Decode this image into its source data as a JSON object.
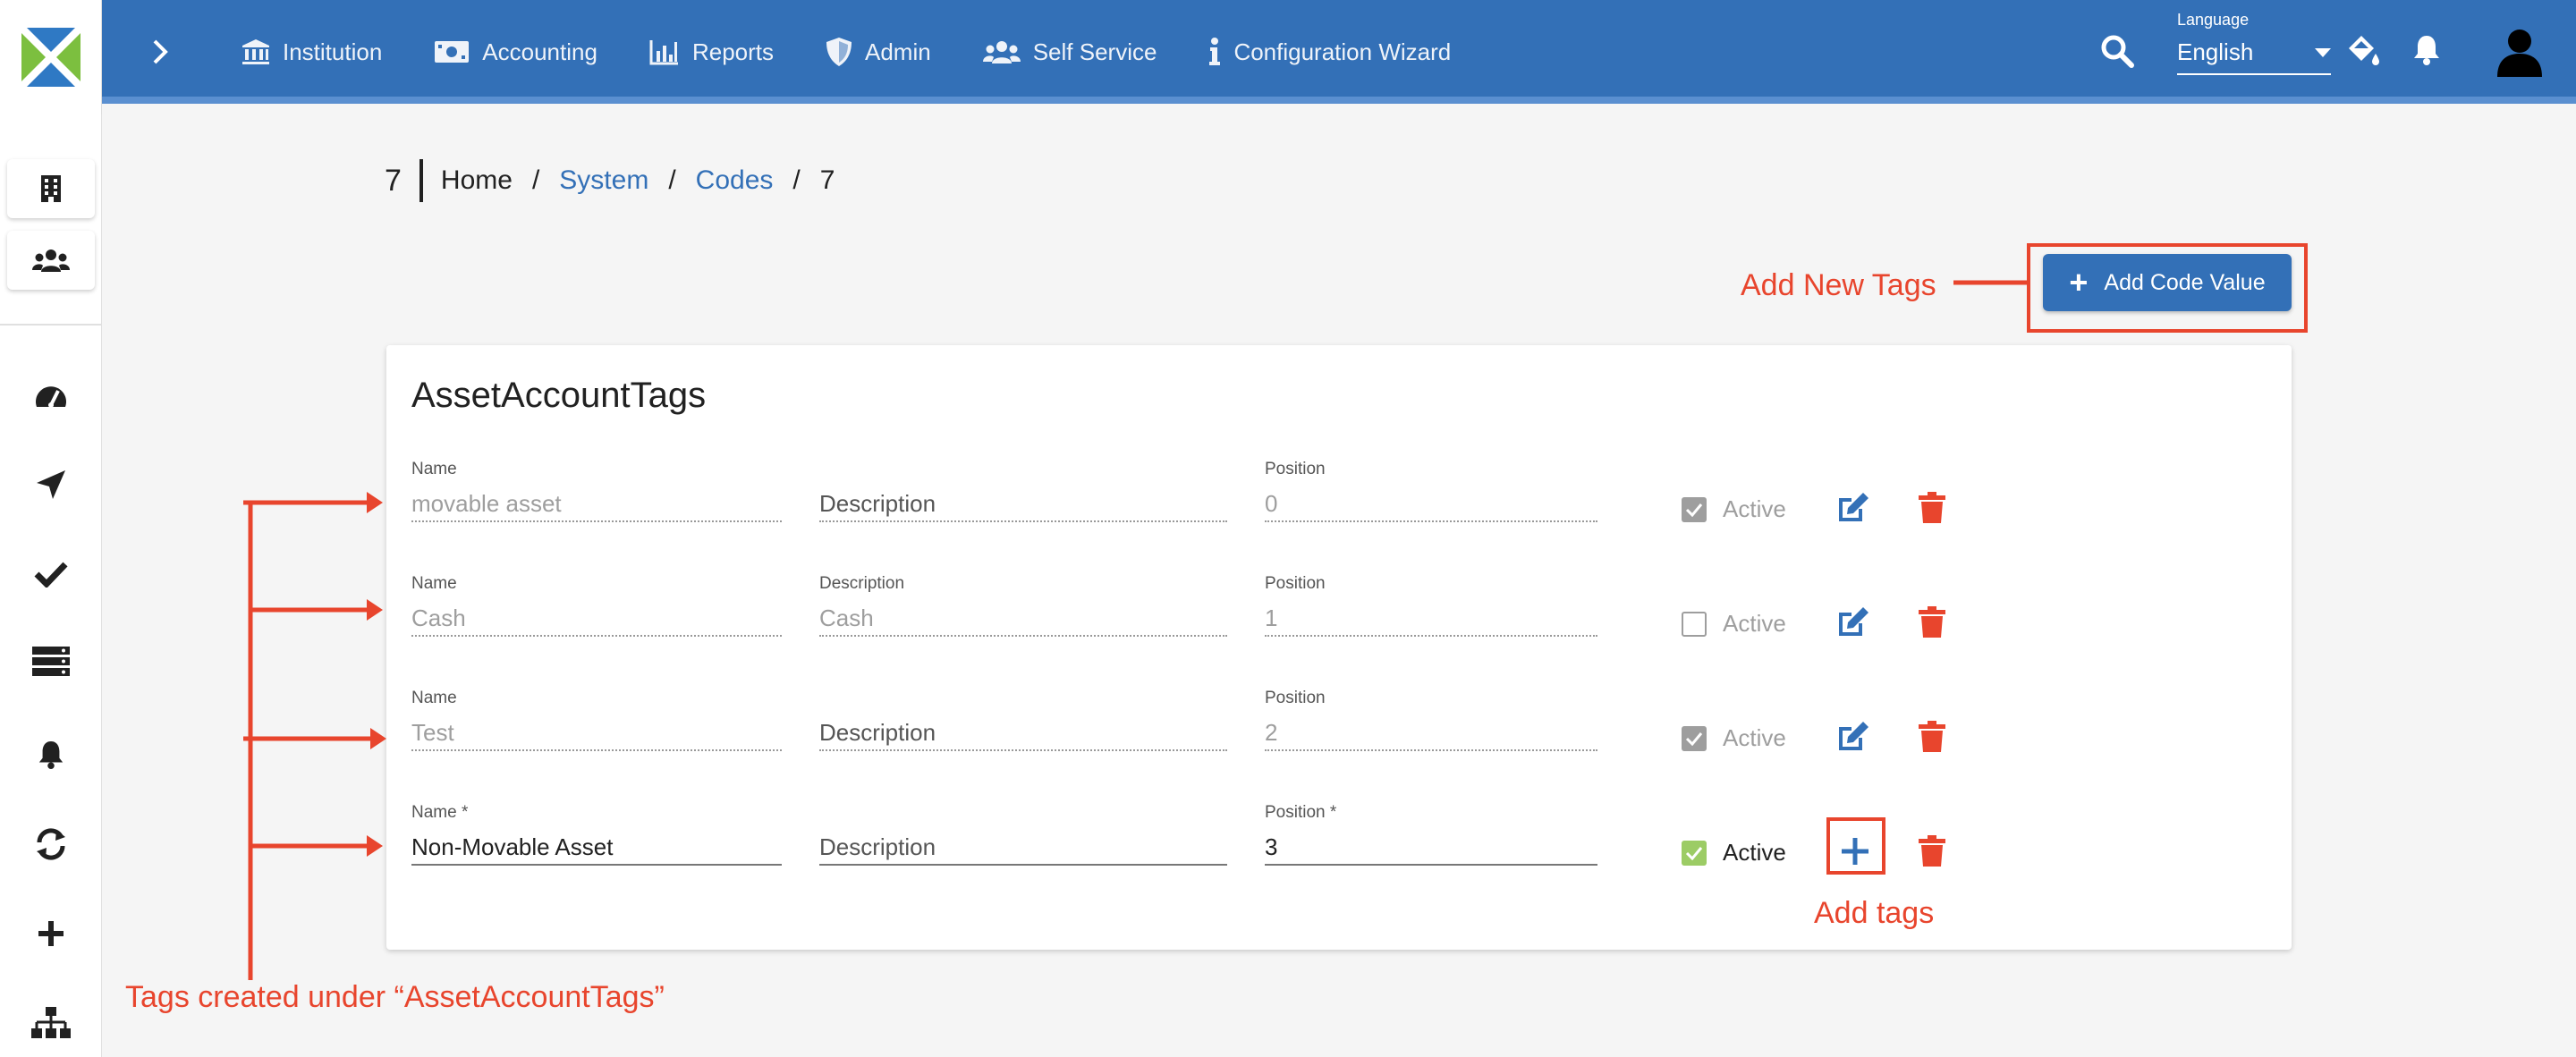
{
  "header": {
    "nav": [
      {
        "label": "Institution",
        "icon": "bank-icon"
      },
      {
        "label": "Accounting",
        "icon": "money-icon"
      },
      {
        "label": "Reports",
        "icon": "chart-icon"
      },
      {
        "label": "Admin",
        "icon": "shield-icon"
      },
      {
        "label": "Self Service",
        "icon": "users-icon"
      },
      {
        "label": "Configuration Wizard",
        "icon": "info-icon"
      }
    ],
    "language": {
      "label": "Language",
      "value": "English"
    }
  },
  "breadcrumb": {
    "number": "7",
    "items": [
      "Home",
      "System",
      "Codes",
      "7"
    ],
    "separator": "/"
  },
  "toolbar": {
    "add_label": "Add Code Value"
  },
  "card": {
    "title": "AssetAccountTags",
    "rows": [
      {
        "name_label": "Name",
        "name": "movable asset",
        "desc_label": "",
        "desc": "Description",
        "pos_label": "Position",
        "pos": "0",
        "active_label": "Active",
        "active": true
      },
      {
        "name_label": "Name",
        "name": "Cash",
        "desc_label": "Description",
        "desc": "Cash",
        "pos_label": "Position",
        "pos": "1",
        "active_label": "Active",
        "active": false
      },
      {
        "name_label": "Name",
        "name": "Test",
        "desc_label": "",
        "desc": "Description",
        "pos_label": "Position",
        "pos": "2",
        "active_label": "Active",
        "active": true
      },
      {
        "name_label": "Name *",
        "name": "Non-Movable Asset",
        "desc_label": "",
        "desc": "Description",
        "pos_label": "Position *",
        "pos": "3",
        "active_label": "Active",
        "active": true
      }
    ]
  },
  "annotations": {
    "add_new_tags": "Add New Tags",
    "add_tags": "Add tags",
    "tags_created": "Tags created under “AssetAccountTags”"
  },
  "colors": {
    "primary": "#3370b7",
    "danger": "#e8452d",
    "active_green": "#9ccc65"
  }
}
